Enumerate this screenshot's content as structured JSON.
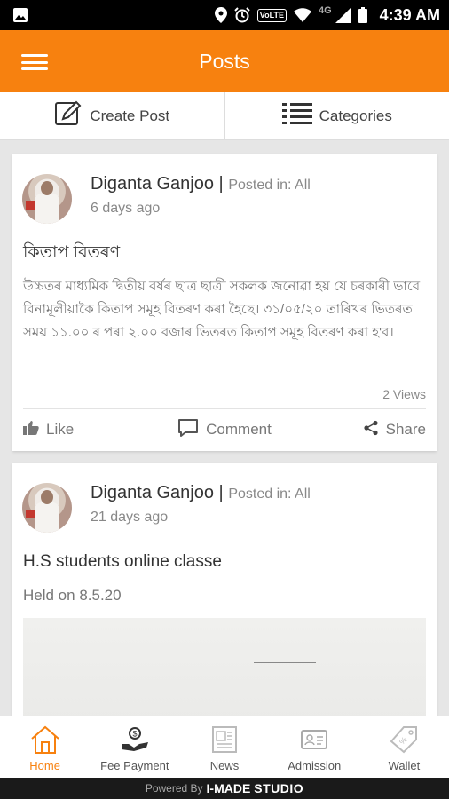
{
  "status_bar": {
    "time": "4:39 AM",
    "volte": "VoLTE",
    "network": "4G"
  },
  "app_bar": {
    "title": "Posts"
  },
  "actions": {
    "create_post": "Create Post",
    "categories": "Categories"
  },
  "posts": [
    {
      "author": "Diganta Ganjoo",
      "separator": "|",
      "posted_in": "Posted in: All",
      "time_ago": "6 days ago",
      "title": "কিতাপ বিতৰণ",
      "body": "উচ্চতৰ মাধ্যমিক দ্বিতীয় বৰ্ষৰ ছাত্ৰ ছাত্ৰী সকলক জনোৱা হয় যে চৰকাৰী ভাবে বিনামূলীয়াকৈ কিতাপ সমূহ বিতৰণ কৰা হৈছে। ৩১/০৫/২০ তাৰিখৰ ভিতৰত সময় ১১.০০ ৰ পৰা ২.০০ বজাৰ ভিতৰত কিতাপ সমূহ বিতৰণ কৰা হ'ব।",
      "views": "2 Views",
      "like": "Like",
      "comment": "Comment",
      "share": "Share"
    },
    {
      "author": "Diganta Ganjoo",
      "separator": "|",
      "posted_in": "Posted in: All",
      "time_ago": "21 days ago",
      "title": "H.S students online classe",
      "body": "Held on 8.5.20"
    }
  ],
  "bottom_nav": [
    {
      "label": "Home",
      "icon": "home-icon",
      "active": true
    },
    {
      "label": "Fee Payment",
      "icon": "fee-payment-icon",
      "active": false
    },
    {
      "label": "News",
      "icon": "news-icon",
      "active": false
    },
    {
      "label": "Admission",
      "icon": "admission-icon",
      "active": false
    },
    {
      "label": "Wallet",
      "icon": "wallet-icon",
      "active": false
    }
  ],
  "powered_by": {
    "prefix": "Powered By",
    "brand": "I-MADE",
    "brand2": "STUDIO"
  },
  "colors": {
    "primary": "#f7810f",
    "statusbar": "#000000",
    "background": "#e6e6e6"
  }
}
